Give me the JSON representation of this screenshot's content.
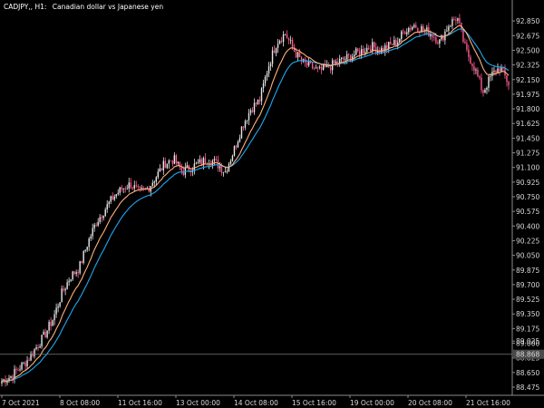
{
  "header": {
    "symbol_tf": "CADJPY,, H1:",
    "description": "Canadian dollar vs Japanese yen"
  },
  "colors": {
    "background": "#000000",
    "axis": "#8a8a8a",
    "text": "#d8d8d8",
    "bull_candle": "#e8e8e8",
    "bear_candle": "#ff5a8c",
    "ma_fast": "#ffb07a",
    "ma_slow": "#1ea8f0",
    "hline": "#7a7a7a",
    "price_tag": "#4a4a4a"
  },
  "chart_data": {
    "type": "candlestick",
    "title": "CADJPY,, H1:  Canadian dollar vs Japanese yen",
    "y_range": [
      88.4,
      91.2
    ],
    "y_ticks": [
      "89.025",
      "88.850",
      "88.675",
      "88.500",
      "88.325",
      "88.150",
      "87.975",
      "87.800",
      "87.625",
      "87.450",
      "87.275",
      "87.100",
      "86.925",
      "86.750",
      "86.575",
      "86.400",
      "86.225",
      "86.050",
      "85.875",
      "85.700",
      "85.525",
      "85.350",
      "85.175",
      "85.000",
      "84.825",
      "84.650",
      "84.475"
    ],
    "y_ticks_display": [
      "89.025",
      "92.850",
      "92.675",
      "92.500",
      "92.325",
      "92.150",
      "91.975",
      "91.800",
      "91.625",
      "91.450",
      "91.275",
      "91.100",
      "90.925",
      "90.750",
      "90.575",
      "90.400",
      "90.225",
      "90.050",
      "89.875",
      "89.700",
      "89.525",
      "89.350",
      "89.175",
      "89.000",
      "88.825",
      "88.650",
      "88.475"
    ],
    "x_ticks": [
      "7 Oct 2021",
      "8 Oct 08:00",
      "11 Oct 16:00",
      "13 Oct 00:00",
      "14 Oct 08:00",
      "15 Oct 16:00",
      "19 Oct 00:00",
      "20 Oct 08:00",
      "21 Oct 16:00"
    ],
    "hline_value": "88.868",
    "series": [
      {
        "name": "",
        "kind": "candles",
        "close_path": [
          88.55,
          88.6,
          88.7,
          88.8,
          88.95,
          89.1,
          89.3,
          89.6,
          89.8,
          89.9,
          90.2,
          90.45,
          90.6,
          90.75,
          90.85,
          90.9,
          90.8,
          90.85,
          91.0,
          91.15,
          91.2,
          91.05,
          91.1,
          91.15,
          91.2,
          91.15,
          91.05,
          91.3,
          91.6,
          91.8,
          91.9,
          92.3,
          92.6,
          92.7,
          92.5,
          92.35,
          92.3,
          92.25,
          92.3,
          92.35,
          92.4,
          92.45,
          92.5,
          92.55,
          92.5,
          92.55,
          92.6,
          92.75,
          92.8,
          92.75,
          92.7,
          92.6,
          92.8,
          92.9,
          92.5,
          92.3,
          92.0,
          92.2,
          92.3,
          92.1
        ]
      },
      {
        "name": "",
        "kind": "ma_fast"
      },
      {
        "name": "",
        "kind": "ma_slow"
      }
    ]
  }
}
